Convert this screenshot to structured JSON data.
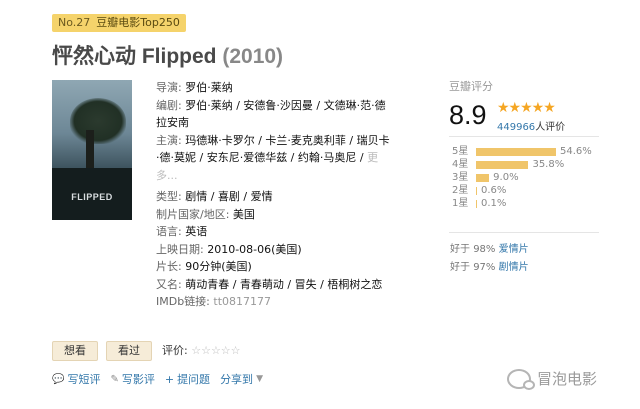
{
  "badge": {
    "rank": "No.27",
    "list": "豆瓣电影Top250"
  },
  "title": {
    "name": "怦然心动 Flipped",
    "year": "(2010)"
  },
  "poster": {
    "text": "FLIPPED"
  },
  "info": {
    "director_label": "导演:",
    "director": "罗伯·莱纳",
    "writer_label": "编剧:",
    "writer": "罗伯·莱纳 / 安德鲁·沙因曼 / 文德琳·范·德拉安南",
    "cast_label": "主演:",
    "cast": "玛德琳·卡罗尔 / 卡兰·麦克奥利菲 / 瑞贝卡·德·莫妮 / 安东尼·爱德华兹 / 约翰·马奥尼 /",
    "cast_more": "更多...",
    "genre_label": "类型:",
    "genre": "剧情 / 喜剧 / 爱情",
    "country_label": "制片国家/地区:",
    "country": "美国",
    "language_label": "语言:",
    "language": "英语",
    "release_label": "上映日期:",
    "release": "2010-08-06(美国)",
    "runtime_label": "片长:",
    "runtime": "90分钟(美国)",
    "aka_label": "又名:",
    "aka": "萌动青春 / 青春萌动 / 冒失 / 梧桐树之恋",
    "imdb_label": "IMDb链接:",
    "imdb": "tt0817177"
  },
  "rating": {
    "label": "豆瓣评分",
    "score": "8.9",
    "stars": "★★★★★",
    "votes": "449966",
    "votes_suffix": "人评价",
    "distribution": [
      {
        "star": "5星",
        "pct": "54.6%",
        "value": 54.6
      },
      {
        "star": "4星",
        "pct": "35.8%",
        "value": 35.8
      },
      {
        "star": "3星",
        "pct": "9.0%",
        "value": 9.0
      },
      {
        "star": "2星",
        "pct": "0.6%",
        "value": 0.6
      },
      {
        "star": "1星",
        "pct": "0.1%",
        "value": 0.1
      }
    ],
    "better1_prefix": "好于",
    "better1_pct": "98%",
    "better1_cat": "爱情片",
    "better2_prefix": "好于",
    "better2_pct": "97%",
    "better2_cat": "剧情片"
  },
  "actions": {
    "want": "想看",
    "seen": "看过",
    "rate_label": "评价:",
    "rate_stars": "☆☆☆☆☆",
    "short_review": "写短评",
    "review": "写影评",
    "ask": "提问题",
    "share": "分享到",
    "plus": "+"
  },
  "watermark": {
    "text": "冒泡电影"
  }
}
